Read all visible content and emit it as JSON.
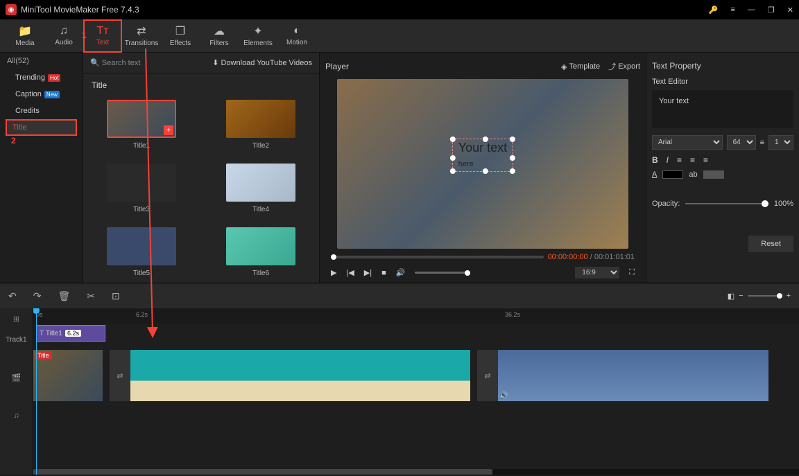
{
  "app": {
    "title": "MiniTool MovieMaker Free 7.4.3"
  },
  "toolbar": [
    {
      "id": "media",
      "label": "Media",
      "icon": "📁"
    },
    {
      "id": "audio",
      "label": "Audio",
      "icon": "♫"
    },
    {
      "id": "text",
      "label": "Text",
      "icon": "Tᴛ",
      "active": true
    },
    {
      "id": "transitions",
      "label": "Transitions",
      "icon": "⇄"
    },
    {
      "id": "effects",
      "label": "Effects",
      "icon": "❐"
    },
    {
      "id": "filters",
      "label": "Filters",
      "icon": "☁"
    },
    {
      "id": "elements",
      "label": "Elements",
      "icon": "✦"
    },
    {
      "id": "motion",
      "label": "Motion",
      "icon": "◐"
    }
  ],
  "sidebar": {
    "all": "All(52)",
    "cats": [
      {
        "label": "Trending",
        "badge": "Hot",
        "badgeClass": "badge-hot"
      },
      {
        "label": "Caption",
        "badge": "New",
        "badgeClass": "badge-new"
      },
      {
        "label": "Credits"
      },
      {
        "label": "Title",
        "selected": true
      }
    ]
  },
  "content": {
    "searchPlaceholder": "Search text",
    "download": "Download YouTube Videos",
    "section": "Title",
    "items": [
      {
        "label": "Title1",
        "selected": true,
        "bg": "linear-gradient(135deg,#6a5a4a,#3a4a5a)"
      },
      {
        "label": "Title2",
        "bg": "linear-gradient(135deg,#a0661a,#6a3a0a)"
      },
      {
        "label": "Title3",
        "bg": "#2a2a2a"
      },
      {
        "label": "Title4",
        "bg": "linear-gradient(135deg,#c8d8e8,#a8b8c8)"
      },
      {
        "label": "Title5",
        "bg": "#3a4a6a"
      },
      {
        "label": "Title6",
        "bg": "linear-gradient(135deg,#5ac8b0,#3aa890)"
      }
    ]
  },
  "player": {
    "label": "Player",
    "template": "Template",
    "export": "Export",
    "overlayText": "Your text",
    "overlaySub": "here",
    "timeCurrent": "00:00:00:00",
    "timeTotal": "00:01:01:01",
    "aspect": "16:9"
  },
  "props": {
    "header": "Text Property",
    "editor": "Text Editor",
    "textValue": "Your text",
    "font": "Arial",
    "size": "64",
    "spacing": "1",
    "opacityLabel": "Opacity:",
    "opacityValue": "100%",
    "reset": "Reset"
  },
  "timeline": {
    "ruler": [
      "0s",
      "6.2s",
      "36.2s"
    ],
    "track1": "Track1",
    "titleClip": {
      "label": "Title1",
      "dur": "6.2s"
    },
    "titleTag": "Title"
  },
  "annotations": {
    "n1": "1",
    "n2": "2"
  }
}
